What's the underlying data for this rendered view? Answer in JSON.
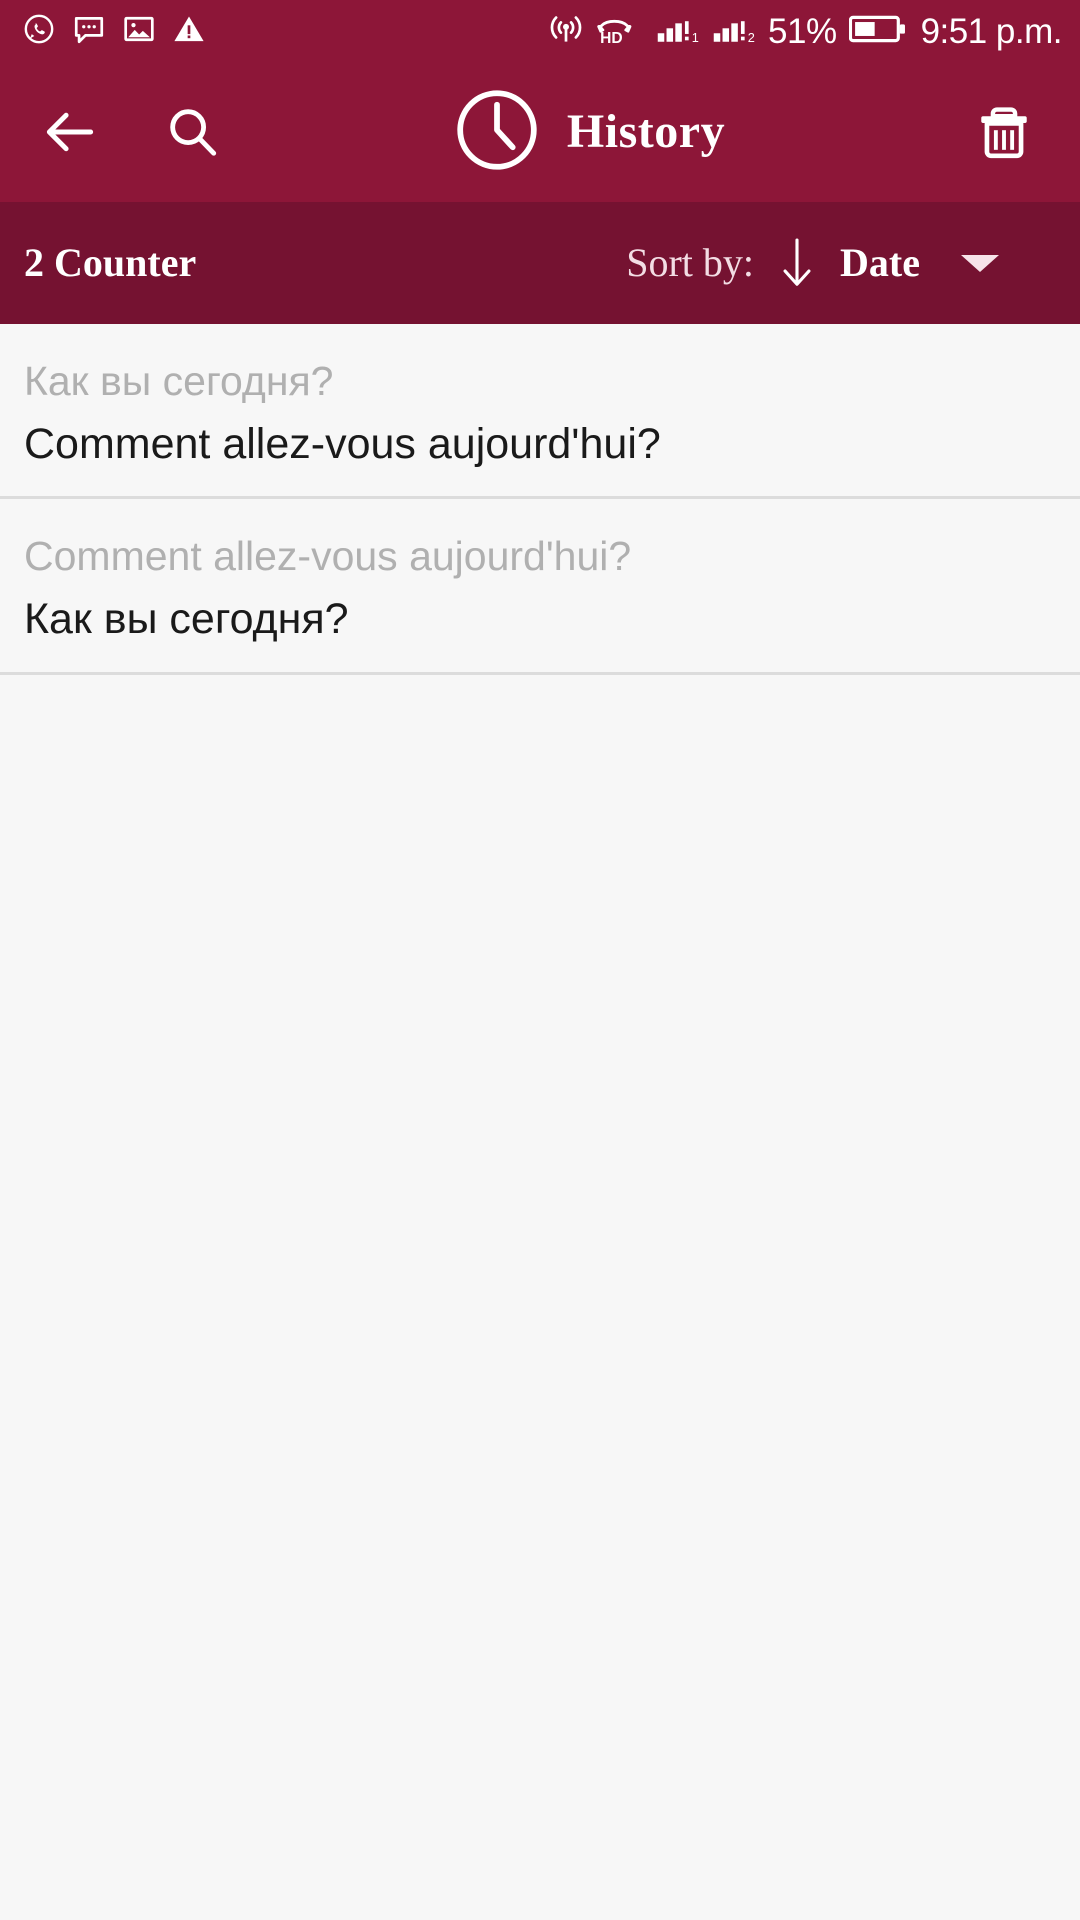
{
  "status_bar": {
    "left_icons": [
      {
        "name": "whatsapp-icon",
        "label": "WhatsApp"
      },
      {
        "name": "message-bubble-icon",
        "label": "Message"
      },
      {
        "name": "image-icon",
        "label": "Screenshot"
      },
      {
        "name": "warning-triangle-icon",
        "label": "Warning"
      }
    ],
    "right_icons": [
      {
        "name": "hotspot-icon",
        "label": "Hotspot"
      },
      {
        "name": "volte-hd-icon",
        "label": "HD"
      },
      {
        "name": "signal-sim1-icon",
        "label": "SIM 1 signal"
      },
      {
        "name": "signal-sim2-icon",
        "label": "SIM 2 signal"
      },
      {
        "name": "battery-icon",
        "label": "Battery"
      }
    ],
    "battery_percent": "51%",
    "battery_level": 51,
    "time": "9:51 p.m."
  },
  "app_bar": {
    "back_label": "Back",
    "search_label": "Search",
    "clock_icon": "clock-icon",
    "title": "History",
    "delete_label": "Delete all"
  },
  "sort_bar": {
    "counter": "2 Counter",
    "sort_by_label": "Sort by:",
    "sort_direction_icon": "arrow-down-icon",
    "sort_value": "Date",
    "dropdown_icon": "chevron-down-icon"
  },
  "history": {
    "items": [
      {
        "source": "Как вы сегодня?",
        "target": "Comment allez-vous aujourd'hui?"
      },
      {
        "source": "Comment allez-vous aujourd'hui?",
        "target": "Как вы сегодня?"
      }
    ]
  },
  "colors": {
    "app_bar": "#8d1638",
    "sort_bar": "#751231",
    "background": "#f7f7f7",
    "source_text": "#b0b0b0",
    "target_text": "#1a1a1a",
    "divider": "#dcdcdc",
    "on_primary": "#ffffff"
  }
}
